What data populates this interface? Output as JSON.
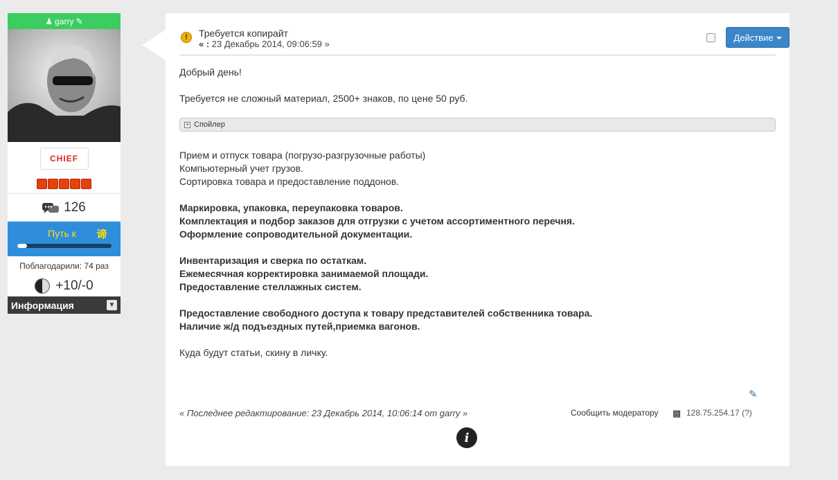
{
  "profile": {
    "username": "garry",
    "user_icon": "user-icon",
    "edit_icon": "pencil-icon",
    "rank": "CHIEF",
    "stars_count": 5,
    "posts_count": "126",
    "path_label": "Путь к",
    "path_icon_glyph": "谛",
    "path_progress_percent": 10,
    "thanks": "Поблагодарили: 74 раз",
    "karma": "+10/-0",
    "info_label": "Информация"
  },
  "post": {
    "title": "Требуется копирайт",
    "date_prefix": "« : ",
    "date": "23 Декабрь 2014, 09:06:59 »",
    "action_label": "Действие",
    "spoiler_label": "Спойлер",
    "lines": {
      "greeting": "Добрый день!",
      "request": "Требуется не сложный материал, 2500+ знаков, по цене 50 руб.",
      "l1": "Прием и отпуск товара (погрузо-разгрузочные работы)",
      "l2": "Компьютерный учет грузов.",
      "l3": "Сортировка товара и предоставление поддонов.",
      "b1": "Маркировка, упаковка, переупаковка товаров.",
      "b2": "Комплектация и подбор заказов для отгрузки с учетом ассортиментного перечня.",
      "b3": "Оформление сопроводительной документации.",
      "b4": "Инвентаризация и сверка по остаткам.",
      "b5": "Ежемесячная корректировка занимаемой площади.",
      "b6": "Предоставление стеллажных систем.",
      "b7": "Предоставление свободного доступа к товару представителей собственника товара.",
      "b8": "Наличие ж/д подъездных путей,приемка вагонов.",
      "closing": "Куда будут статьи, скину в личку."
    },
    "edited": "« Последнее редактирование: 23 Декабрь 2014, 10:06:14 от garry »",
    "report": "Сообщить модератору",
    "ip": "128.75.254.17",
    "ip_help": "(?)"
  },
  "colors": {
    "username_bar": "#3ccd60",
    "action_button": "#3a86c8",
    "path_bar": "#2e8edc",
    "rank_text": "#e02222"
  }
}
